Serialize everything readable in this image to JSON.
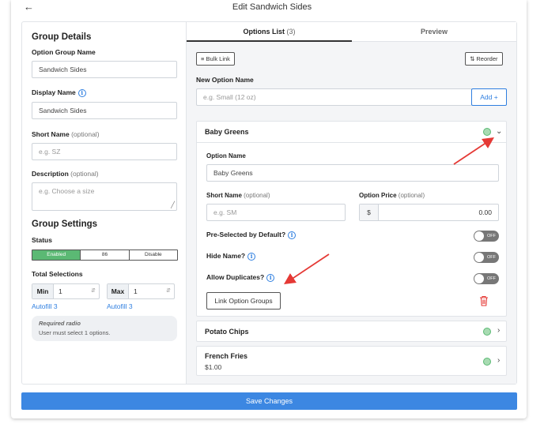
{
  "header": {
    "title": "Edit Sandwich Sides",
    "back_icon": "arrow-left-icon"
  },
  "group_details": {
    "heading": "Group Details",
    "option_group_name_label": "Option Group Name",
    "option_group_name_value": "Sandwich Sides",
    "display_name_label": "Display Name",
    "display_name_value": "Sandwich Sides",
    "short_name_label": "Short Name",
    "short_name_optional": "(optional)",
    "short_name_placeholder": "e.g. SZ",
    "description_label": "Description",
    "description_optional": "(optional)",
    "description_placeholder": "e.g. Choose a size"
  },
  "group_settings": {
    "heading": "Group Settings",
    "status_label": "Status",
    "status_options": [
      "Enabled",
      "86",
      "Disable"
    ],
    "status_selected": "Enabled",
    "total_selections_label": "Total Selections",
    "min_label": "Min",
    "min_value": "1",
    "max_label": "Max",
    "max_value": "1",
    "autofill_min": "Autofill 3",
    "autofill_max": "Autofill 3",
    "note_title": "Required radio",
    "note_text": "User must select 1 options."
  },
  "tabs": {
    "options_list_label": "Options List",
    "options_list_count": "(3)",
    "preview_label": "Preview"
  },
  "toolbar": {
    "bulk_link_label": "Bulk Link",
    "reorder_label": "Reorder"
  },
  "new_option": {
    "label": "New Option Name",
    "placeholder": "e.g. Small (12 oz)",
    "add_label": "Add +"
  },
  "expanded_option": {
    "title": "Baby Greens",
    "option_name_label": "Option Name",
    "option_name_value": "Baby Greens",
    "short_name_label": "Short Name",
    "short_name_optional": "(optional)",
    "short_name_placeholder": "e.g. SM",
    "option_price_label": "Option Price",
    "option_price_optional": "(optional)",
    "currency_symbol": "$",
    "price_value": "0.00",
    "preselected_label": "Pre-Selected by Default?",
    "hide_name_label": "Hide Name?",
    "allow_duplicates_label": "Allow Duplicates?",
    "toggle_off_text": "OFF",
    "link_option_groups_label": "Link Option Groups"
  },
  "collapsed_options": [
    {
      "title": "Potato Chips",
      "price": ""
    },
    {
      "title": "French Fries",
      "price": "$1.00"
    }
  ],
  "footer": {
    "save_label": "Save Changes"
  },
  "colors": {
    "primary": "#3c87e2",
    "enabled": "#5bb974",
    "annotation_arrow": "#e53935",
    "trash": "#e53935"
  }
}
